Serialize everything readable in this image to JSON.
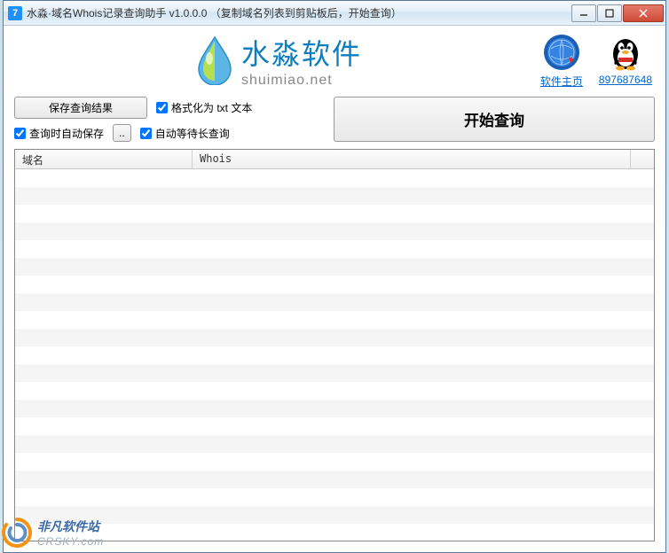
{
  "titlebar": {
    "icon_text": "7",
    "title": "水淼·域名Whois记录查询助手 v1.0.0.0   （复制域名列表到剪贴板后，开始查询）"
  },
  "logo": {
    "cn": "水淼软件",
    "en": "shuimiao.net"
  },
  "header_links": {
    "homepage": "软件主页",
    "qq": "897687648"
  },
  "controls": {
    "save_results": "保存查询结果",
    "format_txt": "格式化为 txt 文本",
    "auto_save": "查询时自动保存",
    "browse": "..",
    "auto_wait": "自动等待长查询",
    "start_query": "开始查询"
  },
  "table": {
    "col_domain": "域名",
    "col_whois": "Whois"
  },
  "watermark": {
    "cn": "非凡软件站",
    "en": "CRSKY.com"
  }
}
